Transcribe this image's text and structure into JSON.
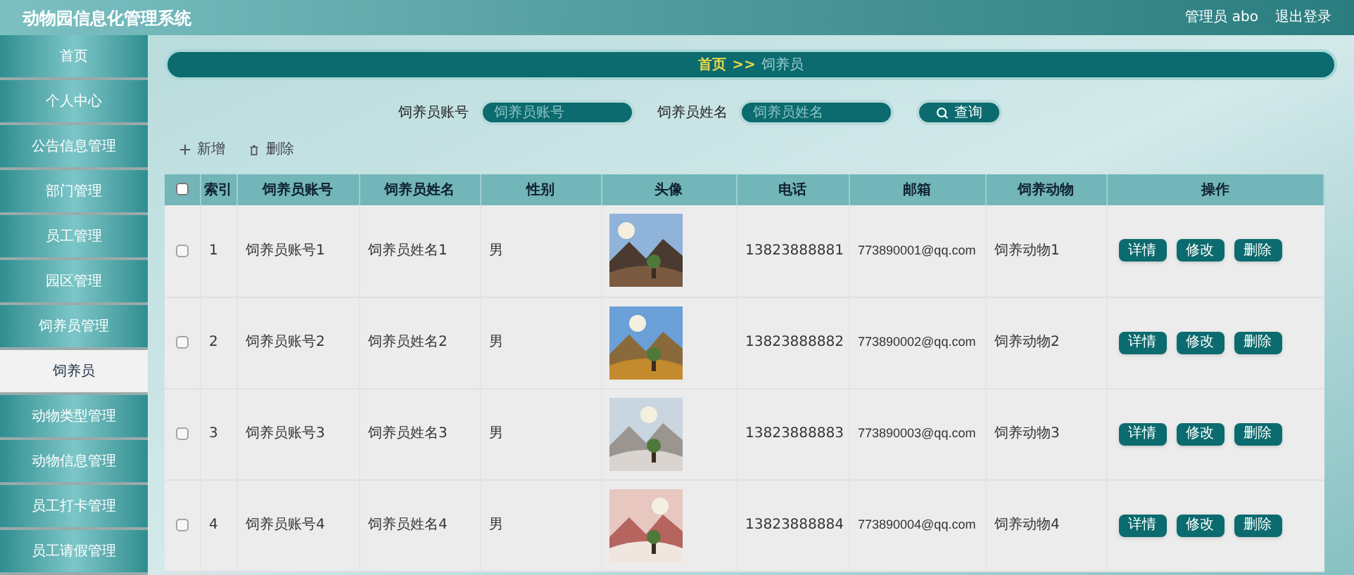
{
  "header": {
    "title": "动物园信息化管理系统",
    "user": "管理员 abo",
    "logout": "退出登录"
  },
  "sidebar": {
    "items": [
      {
        "label": "首页",
        "selected": false
      },
      {
        "label": "个人中心",
        "selected": false
      },
      {
        "label": "公告信息管理",
        "selected": false
      },
      {
        "label": "部门管理",
        "selected": false
      },
      {
        "label": "员工管理",
        "selected": false
      },
      {
        "label": "园区管理",
        "selected": false
      },
      {
        "label": "饲养员管理",
        "selected": false
      },
      {
        "label": "饲养员",
        "selected": true
      },
      {
        "label": "动物类型管理",
        "selected": false
      },
      {
        "label": "动物信息管理",
        "selected": false
      },
      {
        "label": "员工打卡管理",
        "selected": false
      },
      {
        "label": "员工请假管理",
        "selected": false
      }
    ]
  },
  "breadcrumb": {
    "home": "首页",
    "separator": ">>",
    "current": "饲养员"
  },
  "search": {
    "fields": [
      {
        "label": "饲养员账号",
        "placeholder": "饲养员账号"
      },
      {
        "label": "饲养员姓名",
        "placeholder": "饲养员姓名"
      }
    ],
    "button": "查询"
  },
  "actions": [
    {
      "kind": "add",
      "label": "新增"
    },
    {
      "kind": "delete",
      "label": "删除"
    }
  ],
  "table": {
    "select_all_checked": false,
    "columns": [
      "索引",
      "饲养员账号",
      "饲养员姓名",
      "性别",
      "头像",
      "电话",
      "邮箱",
      "饲养动物",
      "操作"
    ],
    "rows": [
      {
        "checked": false,
        "index": "1",
        "account": "饲养员账号1",
        "name": "饲养员姓名1",
        "gender": "男",
        "avatar": {
          "kind": "picture"
        },
        "phone": "13823888881",
        "email": "773890001@qq.com",
        "animal": "饲养动物1",
        "buttons": [
          "详情",
          "修改",
          "删除"
        ]
      },
      {
        "checked": false,
        "index": "2",
        "account": "饲养员账号2",
        "name": "饲养员姓名2",
        "gender": "男",
        "avatar": {
          "kind": "picture"
        },
        "phone": "13823888882",
        "email": "773890002@qq.com",
        "animal": "饲养动物2",
        "buttons": [
          "详情",
          "修改",
          "删除"
        ]
      },
      {
        "checked": false,
        "index": "3",
        "account": "饲养员账号3",
        "name": "饲养员姓名3",
        "gender": "男",
        "avatar": {
          "kind": "picture"
        },
        "phone": "13823888883",
        "email": "773890003@qq.com",
        "animal": "饲养动物3",
        "buttons": [
          "详情",
          "修改",
          "删除"
        ]
      },
      {
        "checked": false,
        "index": "4",
        "account": "饲养员账号4",
        "name": "饲养员姓名4",
        "gender": "男",
        "avatar": {
          "kind": "picture"
        },
        "phone": "13823888884",
        "email": "773890004@qq.com",
        "animal": "饲养动物4",
        "buttons": [
          "详情",
          "修改",
          "删除"
        ]
      }
    ]
  }
}
